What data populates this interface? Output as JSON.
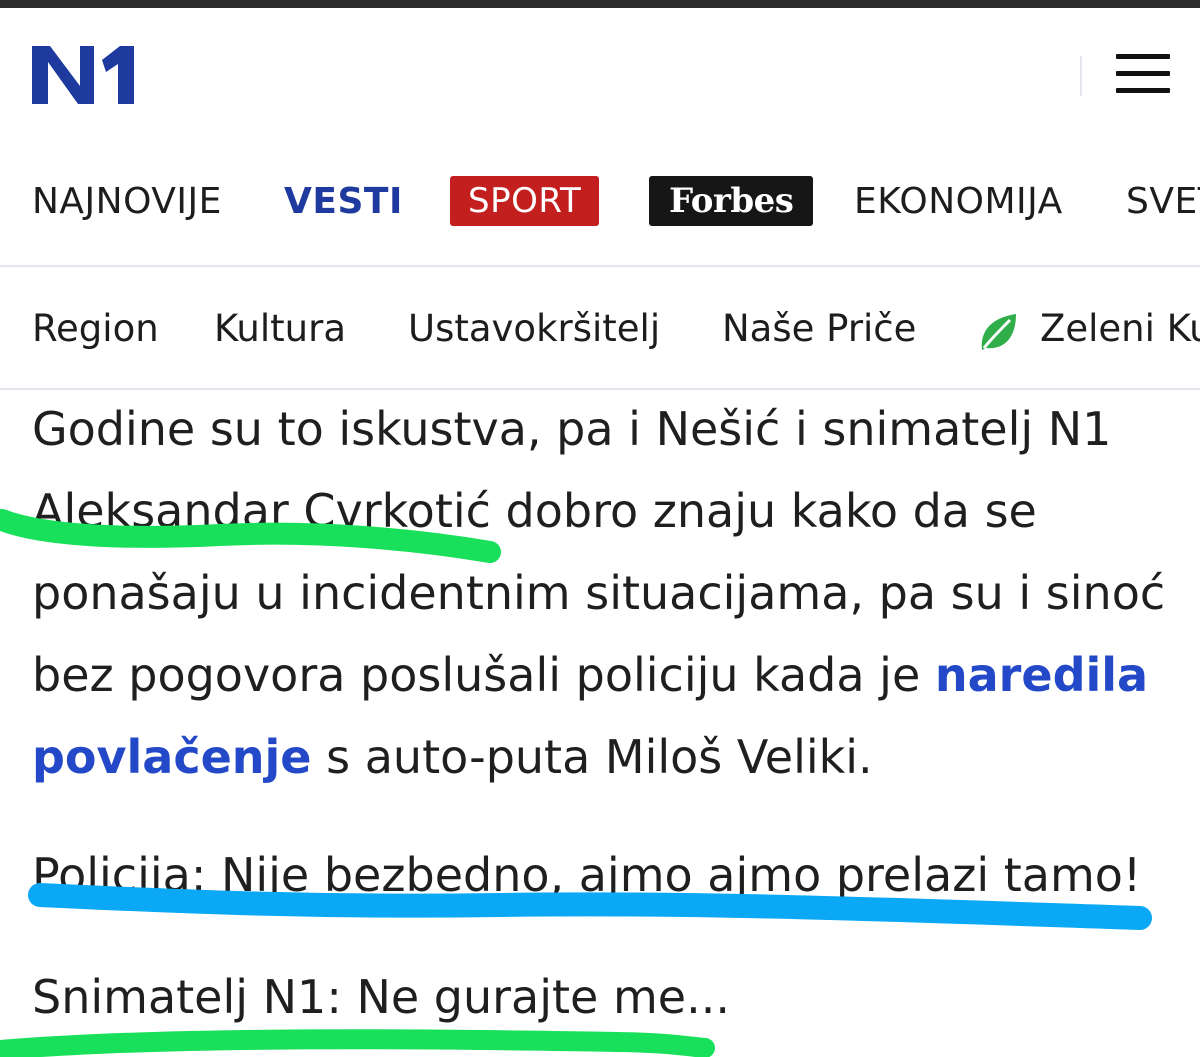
{
  "brand": {
    "logo_text": "N1",
    "logo_color": "#1e3a9e"
  },
  "header": {
    "menu_icon": "hamburger-icon"
  },
  "primary_nav": [
    {
      "label": "NAJNOVIJE"
    },
    {
      "label": "VESTI",
      "active": true
    },
    {
      "label": "SPORT",
      "badge_color": "#c41f1f"
    },
    {
      "label": "Forbes",
      "badge_color": "#161616"
    },
    {
      "label": "EKONOMIJA"
    },
    {
      "label": "SVET"
    }
  ],
  "secondary_nav": [
    {
      "label": "Region"
    },
    {
      "label": "Kultura"
    },
    {
      "label": "Ustavokršitelj"
    },
    {
      "label": "Naše Priče"
    },
    {
      "label": "Zeleni Kutak",
      "icon": "leaf-icon"
    }
  ],
  "article": {
    "paragraph_before_link": "Godine su to iskustva, pa i Nešić i snimatelj N1 Aleksandar Cvrkotić dobro znaju kako da se ponašaju u incidentnim situacijama, pa su i sinoć bez pogovora poslušali policiju kada je ",
    "link_text": "naredila povlačenje",
    "paragraph_after_link": " s auto-puta Miloš Veliki.",
    "dialog_police": "Policija: Nije bezbedno, ajmo ajmo prelazi tamo!",
    "dialog_cameraman": "Snimatelj N1: Ne gurajte me..."
  },
  "colors": {
    "accent_blue": "#1e3a9e",
    "link_blue": "#2348c8",
    "highlight_green": "#19e05a",
    "highlight_blue": "#0aa8f5",
    "leaf_green": "#2fae4a"
  }
}
